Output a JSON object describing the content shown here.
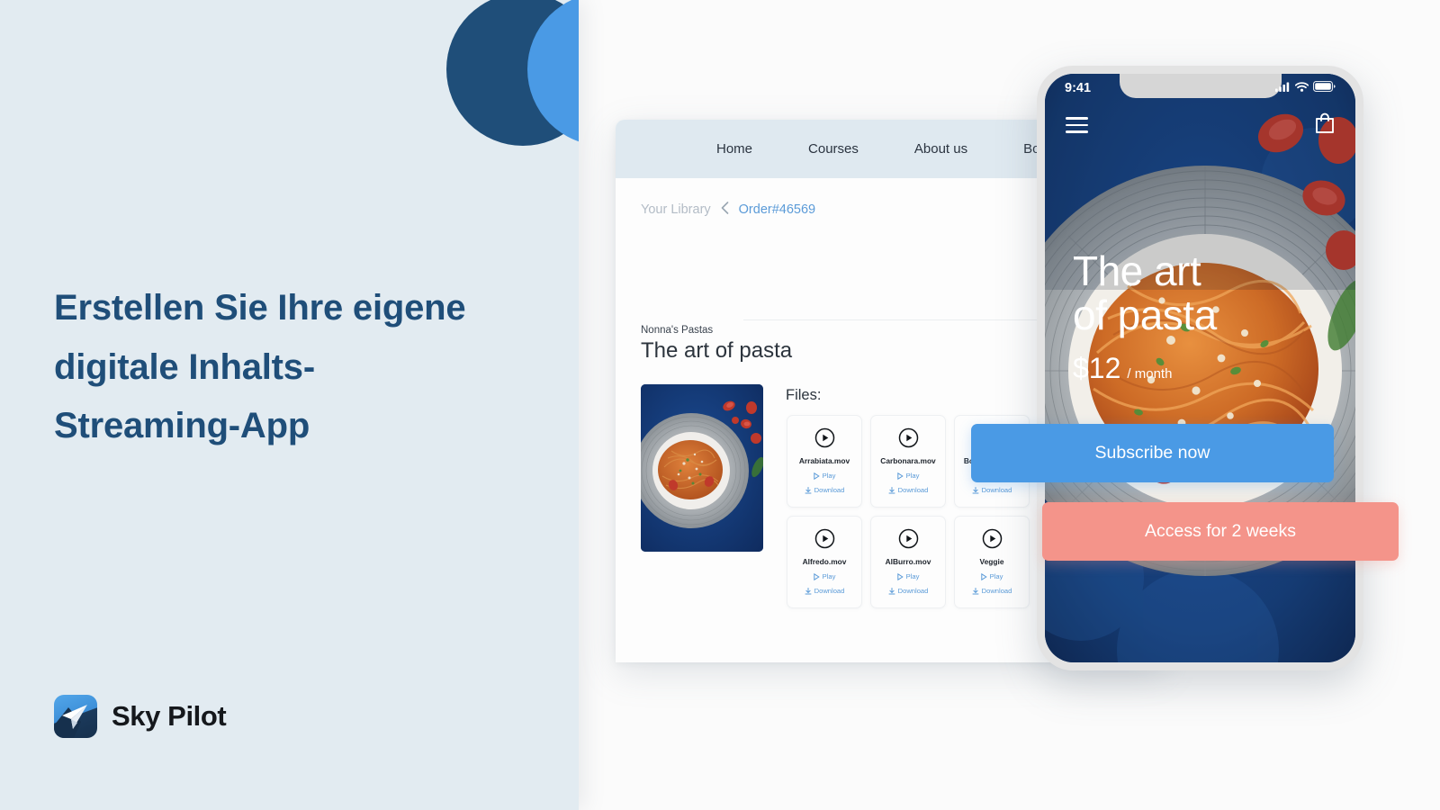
{
  "brand": {
    "name": "Sky Pilot",
    "logo_icon": "paper-plane-icon"
  },
  "hero": {
    "headline": "Erstellen Sie Ihre eigene digitale Inhalts-Streaming-App"
  },
  "colors": {
    "left_background": "#e2ebf1",
    "navy": "#1f4e79",
    "accent_blue": "#4a9ae5",
    "accent_coral": "#f4948a",
    "link_blue": "#5b9bd8",
    "nav_bar": "#dfe9f0"
  },
  "browser": {
    "nav": [
      {
        "label": "Home"
      },
      {
        "label": "Courses"
      },
      {
        "label": "About us"
      },
      {
        "label": "Books"
      }
    ],
    "breadcrumb": {
      "parent": "Your Library",
      "chevron_icon": "chevron-left-icon",
      "current": "Order#46569"
    },
    "product": {
      "brand": "Nonna's Pastas",
      "title": "The art of pasta",
      "thumbnail_alt": "pasta-dish-thumbnail"
    },
    "files_label": "Files:",
    "file_actions": {
      "play": "Play",
      "download": "Download"
    },
    "files": [
      {
        "name": "Arrabiata.mov"
      },
      {
        "name": "Carbonara.mov"
      },
      {
        "name": "Bolognese.mov"
      },
      {
        "name": "Alfredo.mov"
      },
      {
        "name": "AlBurro.mov"
      },
      {
        "name": "Veggie"
      }
    ]
  },
  "phone": {
    "status": {
      "time": "9:41",
      "signal_icon": "cellular-signal-icon",
      "wifi_icon": "wifi-icon",
      "battery_icon": "battery-full-icon"
    },
    "app_bar": {
      "menu_icon": "hamburger-menu-icon",
      "cart_icon": "shopping-bag-icon"
    },
    "hero": {
      "title_line1": "The art",
      "title_line2": "of pasta",
      "price": "$12",
      "period": "/ month"
    },
    "cta_primary": "Subscribe now",
    "cta_secondary": "Access for 2 weeks"
  }
}
